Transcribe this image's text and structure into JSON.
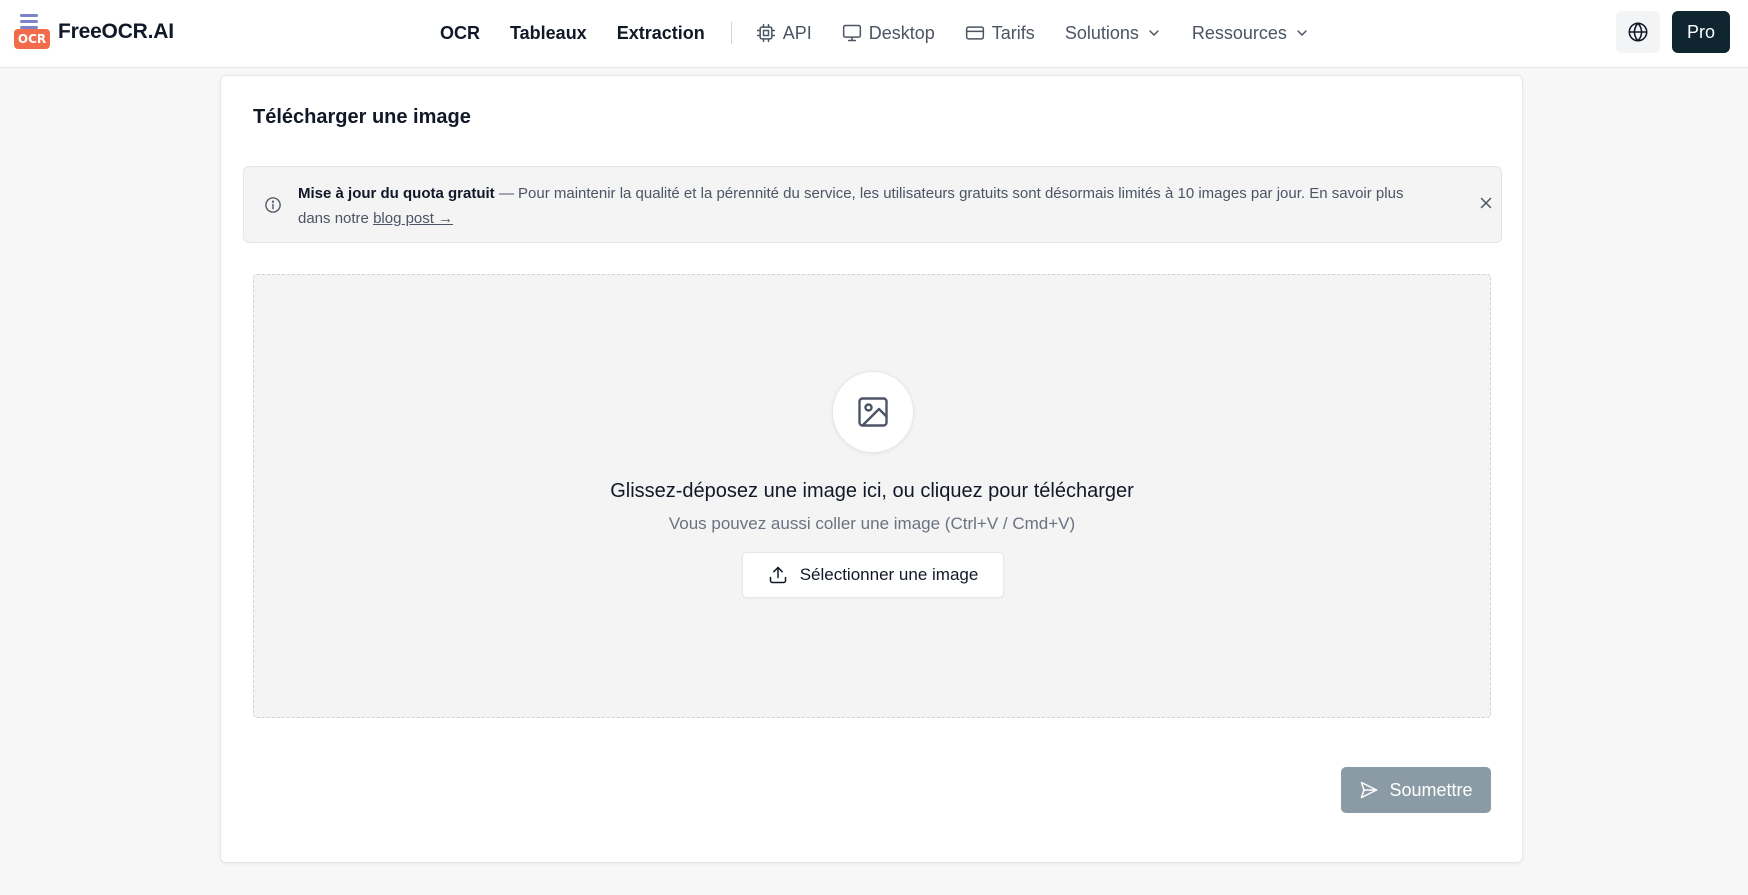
{
  "brand": {
    "name": "FreeOCR.AI",
    "logo_badge": "OCR",
    "colors": {
      "badge": "#f26b4a",
      "lines": "#7c83c8"
    }
  },
  "nav": {
    "ocr": "OCR",
    "tableaux": "Tableaux",
    "extraction": "Extraction",
    "api": "API",
    "desktop": "Desktop",
    "tarifs": "Tarifs",
    "solutions": "Solutions",
    "ressources": "Ressources",
    "icons": {
      "api": "chip-icon",
      "desktop": "monitor-icon",
      "tarifs": "credit-card-icon",
      "dropdown": "chevron-down-icon"
    }
  },
  "header_actions": {
    "language_icon": "globe-icon",
    "pro_label": "Pro",
    "pro_color": "#0f2530"
  },
  "upload": {
    "title": "Télécharger une image",
    "notice": {
      "title": "Mise à jour du quota gratuit",
      "body": " — Pour maintenir la qualité et la pérennité du service, les utilisateurs gratuits sont désormais limités à 10 images par jour. En savoir plus dans notre ",
      "link_label": "blog post →"
    },
    "dropzone": {
      "title": "Glissez-déposez une image ici, ou cliquez pour télécharger",
      "subtitle": "Vous pouvez aussi coller une image (Ctrl+V / Cmd+V)",
      "select_label": "Sélectionner une image",
      "icon": "image-icon"
    },
    "submit_label": "Soumettre",
    "submit_color": "#8a9ba6"
  }
}
